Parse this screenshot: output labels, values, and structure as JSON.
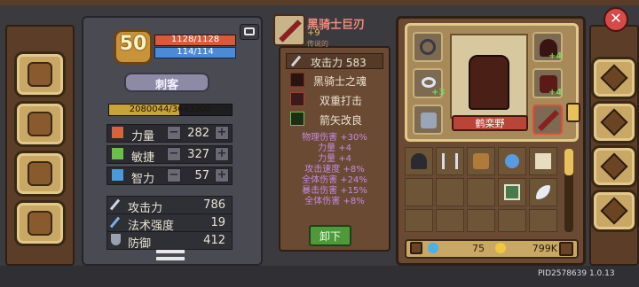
{
  "hero": {
    "level": "50",
    "hp": "1128/1128",
    "mp": "114/114",
    "class_name": "刺客",
    "xp": "2080044/3643300",
    "xp_fraction": 0.571
  },
  "attributes": [
    {
      "label": "力量",
      "value": "282"
    },
    {
      "label": "敏捷",
      "value": "327"
    },
    {
      "label": "智力",
      "value": "57"
    }
  ],
  "combat_stats": [
    {
      "label": "攻击力",
      "value": "786"
    },
    {
      "label": "法术强度",
      "value": "19"
    },
    {
      "label": "防御",
      "value": "412"
    }
  ],
  "weapon": {
    "name": "黑骑士巨刃",
    "enhance": "+9",
    "subtitle": "传说的",
    "attack": "攻击力 583",
    "skills": [
      "黑骑士之魂",
      "双重打击",
      "箭矢改良"
    ],
    "bonuses": [
      "物理伤害 +30%",
      "力量 +4",
      "力量 +4",
      "攻击速度 +8%",
      "全体伤害 +24%",
      "暴击伤害 +15%",
      "全体伤害 +8%"
    ],
    "unequip_label": "卸下"
  },
  "character": {
    "name": "鹤栾野",
    "enh_left": "+3",
    "enh_right_top": "+4",
    "enh_right_mid": "+4"
  },
  "inventory": {
    "gems": "75",
    "coins": "799K"
  },
  "footer": {
    "pid": "PID2578639 1.0.13"
  },
  "colors": {
    "accent": "#d64a4a",
    "gold": "#e8c15a",
    "bonus": "#c48be0"
  }
}
